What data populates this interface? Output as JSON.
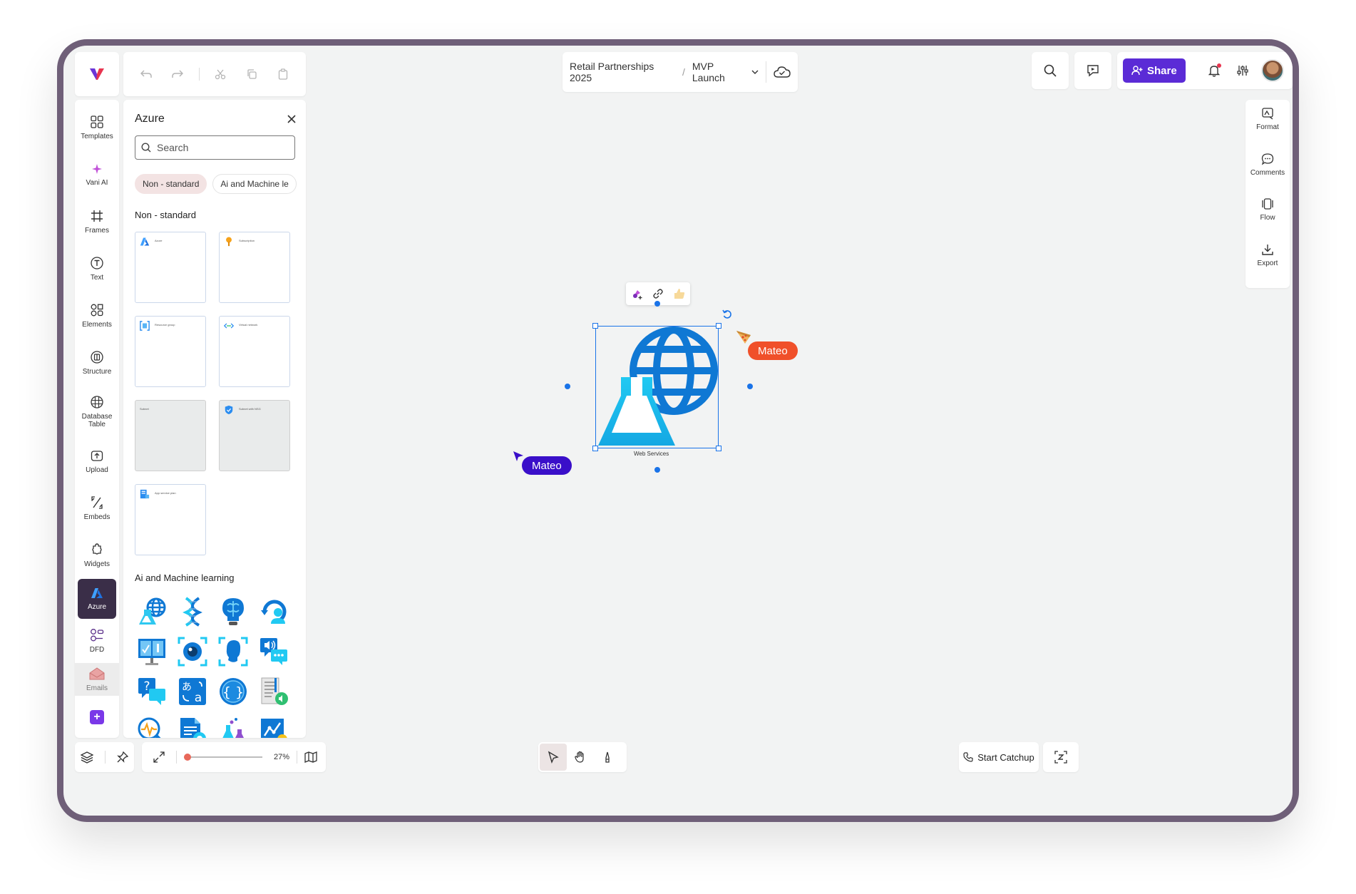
{
  "breadcrumb": {
    "project": "Retail Partnerships 2025",
    "board": "MVP Launch"
  },
  "top": {
    "share_label": "Share"
  },
  "sidebar": {
    "items": [
      {
        "label": "Templates"
      },
      {
        "label": "Vani AI"
      },
      {
        "label": "Frames"
      },
      {
        "label": "Text"
      },
      {
        "label": "Elements"
      },
      {
        "label": "Structure"
      },
      {
        "label": "Database Table"
      },
      {
        "label": "Upload"
      },
      {
        "label": "Embeds"
      },
      {
        "label": "Widgets"
      },
      {
        "label": "Azure"
      },
      {
        "label": "DFD"
      },
      {
        "label": "Emails"
      }
    ]
  },
  "panel": {
    "title": "Azure",
    "search_placeholder": "Search",
    "chips": [
      "Non - standard",
      "Ai and Machine le"
    ],
    "section_non_standard": "Non - standard",
    "tiles": [
      "Azure",
      "Subscription",
      "Resource group",
      "Virtual network",
      "Subnet",
      "Subnet with NSG",
      "App service plan"
    ],
    "section_ai": "Ai and Machine learning"
  },
  "right_strip": {
    "items": [
      {
        "label": "Format"
      },
      {
        "label": "Comments"
      },
      {
        "label": "Flow"
      },
      {
        "label": "Export"
      }
    ]
  },
  "canvas": {
    "shape_label": "Web Services",
    "cursor_1": "Mateo",
    "cursor_2": "Mateo"
  },
  "bottom": {
    "zoom": "27%",
    "catchup_label": "Start Catchup"
  },
  "colors": {
    "accent": "#5b2bd6",
    "selection": "#1a73e8",
    "cursor_orange": "#f0502a",
    "cursor_purple": "#3a0fc9",
    "azure_blue": "#0f78d4",
    "azure_cyan": "#21c9f2"
  }
}
